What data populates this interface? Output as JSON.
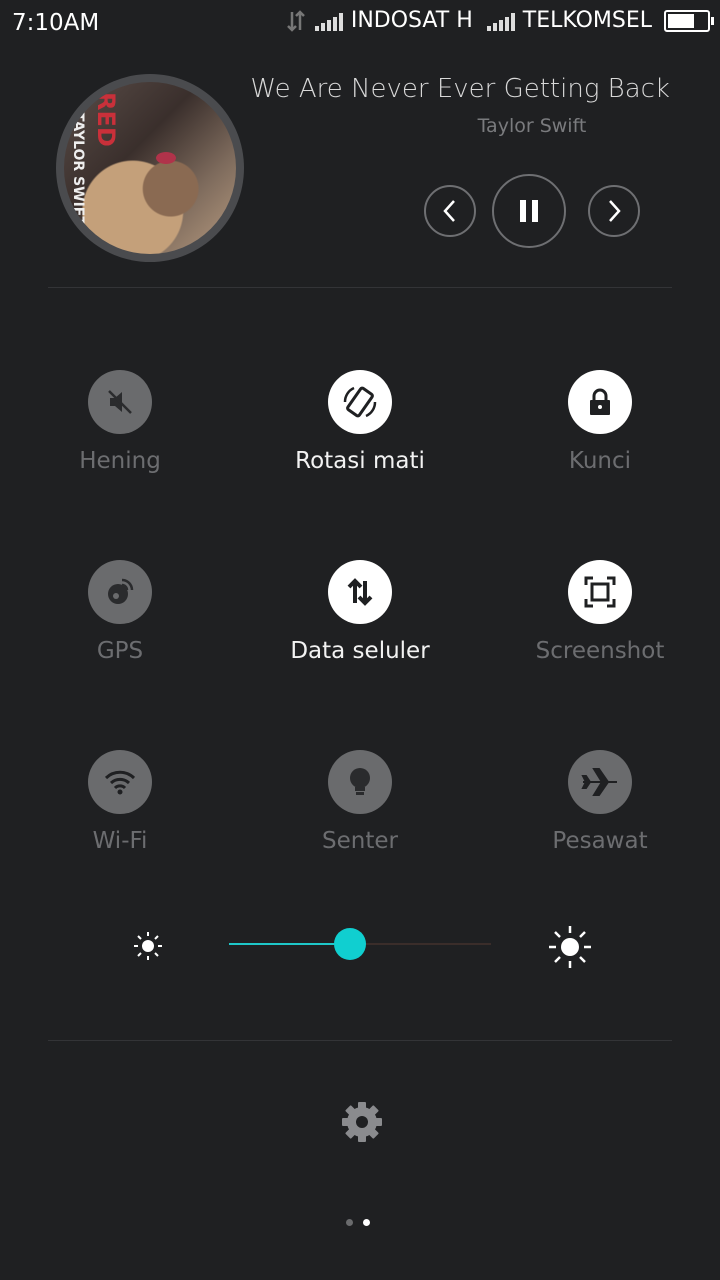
{
  "status_bar": {
    "time": "7:10AM",
    "carrier1": "INDOSAT H",
    "carrier2": "TELKOMSEL",
    "battery_level": 0.65
  },
  "media": {
    "album_text_red": "RED",
    "album_text_artist": "TAYLOR SWIFT",
    "title": "We Are Never Ever Getting Back",
    "artist": "Taylor Swift",
    "prev_icon": "chevron-left-icon",
    "play_icon": "pause-icon",
    "next_icon": "chevron-right-icon"
  },
  "toggles": [
    {
      "label": "Hening",
      "icon": "mute-icon",
      "state": "off"
    },
    {
      "label": "Rotasi mati",
      "icon": "rotation-icon",
      "state": "on"
    },
    {
      "label": "Kunci",
      "icon": "lock-icon",
      "state": "off"
    },
    {
      "label": "GPS",
      "icon": "gps-icon",
      "state": "off"
    },
    {
      "label": "Data seluler",
      "icon": "mobile-data-icon",
      "state": "on"
    },
    {
      "label": "Screenshot",
      "icon": "screenshot-icon",
      "state": "off"
    },
    {
      "label": "Wi-Fi",
      "icon": "wifi-icon",
      "state": "off"
    },
    {
      "label": "Senter",
      "icon": "flashlight-icon",
      "state": "off"
    },
    {
      "label": "Pesawat",
      "icon": "airplane-icon",
      "state": "off"
    }
  ],
  "brightness": {
    "level": 0.46,
    "accent": "#10cfd0"
  },
  "pager": {
    "count": 2,
    "active": 1
  },
  "colors": {
    "background": "#1f2022",
    "toggle_on": "#ffffff",
    "toggle_off": "#6a6b6d"
  }
}
